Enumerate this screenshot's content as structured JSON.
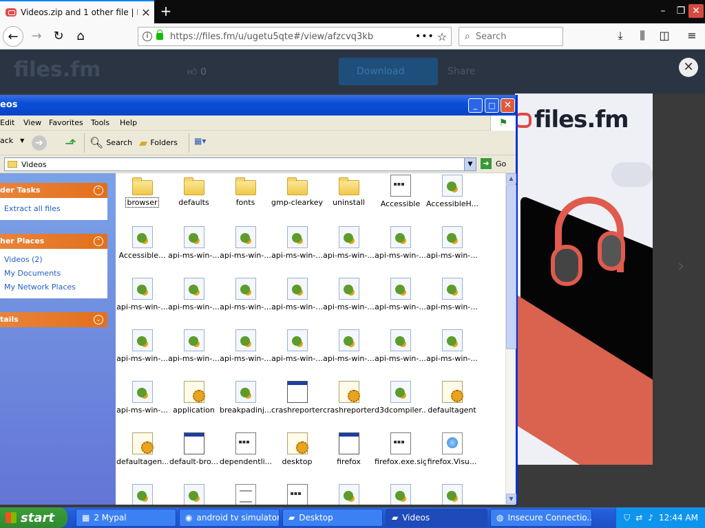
{
  "browser": {
    "tab_title": "Videos.zip and 1 other file | Files.f",
    "tab_close": "✕",
    "new_tab": "+",
    "url": "https://files.fm/u/ugetu5qte#/view/afzcvq3kb",
    "url_more": "•••",
    "search_placeholder": "Search"
  },
  "page": {
    "logo_text": "files.fm",
    "likes": "0",
    "download_label": "Download",
    "share_label": "Share",
    "ad_brand": "files.fm"
  },
  "explorer": {
    "title": "eos",
    "menu": [
      "Edit",
      "View",
      "Favorites",
      "Tools",
      "Help"
    ],
    "toolbar": {
      "back": "ack",
      "search": "Search",
      "folders": "Folders"
    },
    "address": "Videos",
    "go": "Go",
    "tasks": {
      "folder_tasks_title": "der Tasks",
      "folder_tasks_items": [
        "Extract all files"
      ],
      "other_places_title": "her Places",
      "other_places_items": [
        "Videos (2)",
        "My Documents",
        "My Network Places"
      ],
      "details_title": "tails"
    },
    "files": [
      {
        "name": "browser",
        "type": "folder"
      },
      {
        "name": "defaults",
        "type": "folder"
      },
      {
        "name": "fonts",
        "type": "folder"
      },
      {
        "name": "gmp-clearkey",
        "type": "folder"
      },
      {
        "name": "uninstall",
        "type": "folder"
      },
      {
        "name": "Accessible",
        "type": "exe2"
      },
      {
        "name": "AccessibleH...",
        "type": "dll"
      },
      {
        "name": "Accessible...",
        "type": "dll"
      },
      {
        "name": "api-ms-win-...",
        "type": "dll"
      },
      {
        "name": "api-ms-win-...",
        "type": "dll"
      },
      {
        "name": "api-ms-win-...",
        "type": "dll"
      },
      {
        "name": "api-ms-win-...",
        "type": "dll"
      },
      {
        "name": "api-ms-win-...",
        "type": "dll"
      },
      {
        "name": "api-ms-win-...",
        "type": "dll"
      },
      {
        "name": "api-ms-win-...",
        "type": "dll"
      },
      {
        "name": "api-ms-win-...",
        "type": "dll"
      },
      {
        "name": "api-ms-win-...",
        "type": "dll"
      },
      {
        "name": "api-ms-win-...",
        "type": "dll"
      },
      {
        "name": "api-ms-win-...",
        "type": "dll"
      },
      {
        "name": "api-ms-win-...",
        "type": "dll"
      },
      {
        "name": "api-ms-win-...",
        "type": "dll"
      },
      {
        "name": "api-ms-win-...",
        "type": "dll"
      },
      {
        "name": "api-ms-win-...",
        "type": "dll"
      },
      {
        "name": "api-ms-win-...",
        "type": "dll"
      },
      {
        "name": "api-ms-win-...",
        "type": "dll"
      },
      {
        "name": "api-ms-win-...",
        "type": "dll"
      },
      {
        "name": "api-ms-win-...",
        "type": "dll"
      },
      {
        "name": "api-ms-win-...",
        "type": "dll"
      },
      {
        "name": "api-ms-win-...",
        "type": "dll"
      },
      {
        "name": "application",
        "type": "cfg"
      },
      {
        "name": "breakpadinj...",
        "type": "dll"
      },
      {
        "name": "crashreporter",
        "type": "exe"
      },
      {
        "name": "crashreporter",
        "type": "cfg"
      },
      {
        "name": "d3dcompiler...",
        "type": "dll"
      },
      {
        "name": "defaultagent",
        "type": "cfg"
      },
      {
        "name": "defaultagen...",
        "type": "cfg"
      },
      {
        "name": "default-bro...",
        "type": "exe"
      },
      {
        "name": "dependentli...",
        "type": "exe2"
      },
      {
        "name": "desktop",
        "type": "cfg"
      },
      {
        "name": "firefox",
        "type": "exe"
      },
      {
        "name": "firefox.exe.sig",
        "type": "exe2"
      },
      {
        "name": "firefox.Visu...",
        "type": "web"
      },
      {
        "name": "",
        "type": "dll"
      },
      {
        "name": "",
        "type": "dll"
      },
      {
        "name": "",
        "type": "txt"
      },
      {
        "name": "",
        "type": "exe2"
      },
      {
        "name": "",
        "type": "dll"
      },
      {
        "name": "",
        "type": "dll"
      },
      {
        "name": "",
        "type": "dll"
      }
    ]
  },
  "taskbar": {
    "start": "start",
    "items": [
      "2 Mypal",
      "android tv simulator...",
      "Desktop",
      "Videos",
      "Insecure Connectio..."
    ],
    "clock": "12:44 AM"
  },
  "colors": {
    "xp_title_blue": "#0a4fd7",
    "task_orange": "#e3701a",
    "taskbar_blue": "#245edb",
    "start_green": "#3c9c3c"
  }
}
